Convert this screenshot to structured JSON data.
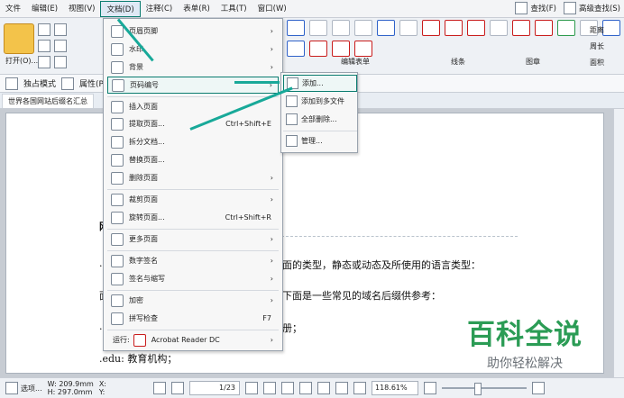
{
  "menubar": {
    "items": [
      "文件",
      "编辑(E)",
      "视图(V)",
      "文档(D)",
      "注释(C)",
      "表单(R)",
      "工具(T)",
      "窗口(W)"
    ],
    "right_buttons": [
      "查找(F)",
      "高级查找(S)"
    ]
  },
  "toolbar": {
    "open_label": "打开(O)...",
    "tools": [
      {
        "name": "编辑表单"
      },
      {
        "name": "线条"
      },
      {
        "name": "图章"
      },
      {
        "name": "距离"
      },
      {
        "name": "周长"
      },
      {
        "name": "面积"
      }
    ],
    "secondary": [
      "独占模式",
      "属性(P)..."
    ]
  },
  "document": {
    "tab_title": "世界各国网站后缀名汇总",
    "lines": [
      "面的类型，静态或动态及所使用的语言类型：",
      "下面是一些常见的域名后缀供参考：",
      "册；",
      ".edu: 教育机构；"
    ],
    "left_fragments": [
      "网",
      ".",
      "面",
      "."
    ]
  },
  "dropdown": {
    "items": [
      {
        "label": "页眉页脚",
        "arrow": true
      },
      {
        "label": "水印",
        "arrow": true
      },
      {
        "label": "背景",
        "arrow": true
      },
      {
        "label": "页码编号",
        "arrow": true,
        "highlight": true
      },
      {
        "label": "插入页面"
      },
      {
        "label": "提取页面...",
        "shortcut": "Ctrl+Shift+E"
      },
      {
        "label": "拆分文档..."
      },
      {
        "label": "替换页面..."
      },
      {
        "label": "删除页面",
        "arrow": true
      },
      {
        "label": "裁剪页面",
        "arrow": true
      },
      {
        "label": "旋转页面...",
        "shortcut": "Ctrl+Shift+R"
      },
      {
        "label": "更多页面",
        "arrow": true
      },
      {
        "label": "数字签名",
        "arrow": true
      },
      {
        "label": "签名与缩写",
        "arrow": true
      },
      {
        "label": "加密",
        "arrow": true
      },
      {
        "label": "拼写检查",
        "shortcut": "F7"
      },
      {
        "label": "运行:",
        "app": "Acrobat Reader DC",
        "arrow": true
      }
    ]
  },
  "submenu": {
    "items": [
      {
        "label": "添加...",
        "highlight": true
      },
      {
        "label": "添加到多文件"
      },
      {
        "label": "全部删除..."
      },
      {
        "label": "管理..."
      }
    ]
  },
  "status": {
    "options_label": "选项...",
    "width": "W: 209.9mm",
    "height": "H: 297.0mm",
    "x": "X:",
    "y": "Y:",
    "page": "1/23",
    "zoom": "118.61%"
  },
  "watermark": {
    "title": "百科全说",
    "subtitle": "助你轻松解决"
  },
  "colors": {
    "accent": "#0a7c6f",
    "arrow": "#18a999",
    "watermark_green": "#2b9c55"
  }
}
